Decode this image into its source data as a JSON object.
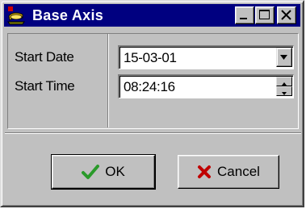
{
  "window": {
    "title": "Base Axis",
    "app_icon": "app-icon",
    "titlebar_color": "#000080",
    "face_color": "#c0c0c0"
  },
  "titlebar_buttons": {
    "minimize_icon": "minimize-icon",
    "maximize_icon": "maximize-icon",
    "close_icon": "close-icon"
  },
  "form": {
    "start_date": {
      "label": "Start Date",
      "value": "15-03-01",
      "control": "dropdown",
      "icon": "chevron-down-icon"
    },
    "start_time": {
      "label": "Start Time",
      "value": "08:24:16",
      "control": "spinner",
      "icons": [
        "spin-up-icon",
        "spin-down-icon"
      ]
    }
  },
  "buttons": {
    "ok": {
      "label": "OK",
      "icon": "checkmark-icon",
      "icon_color": "#2a9a2a"
    },
    "cancel": {
      "label": "Cancel",
      "icon": "cross-icon",
      "icon_color": "#c00000"
    }
  }
}
